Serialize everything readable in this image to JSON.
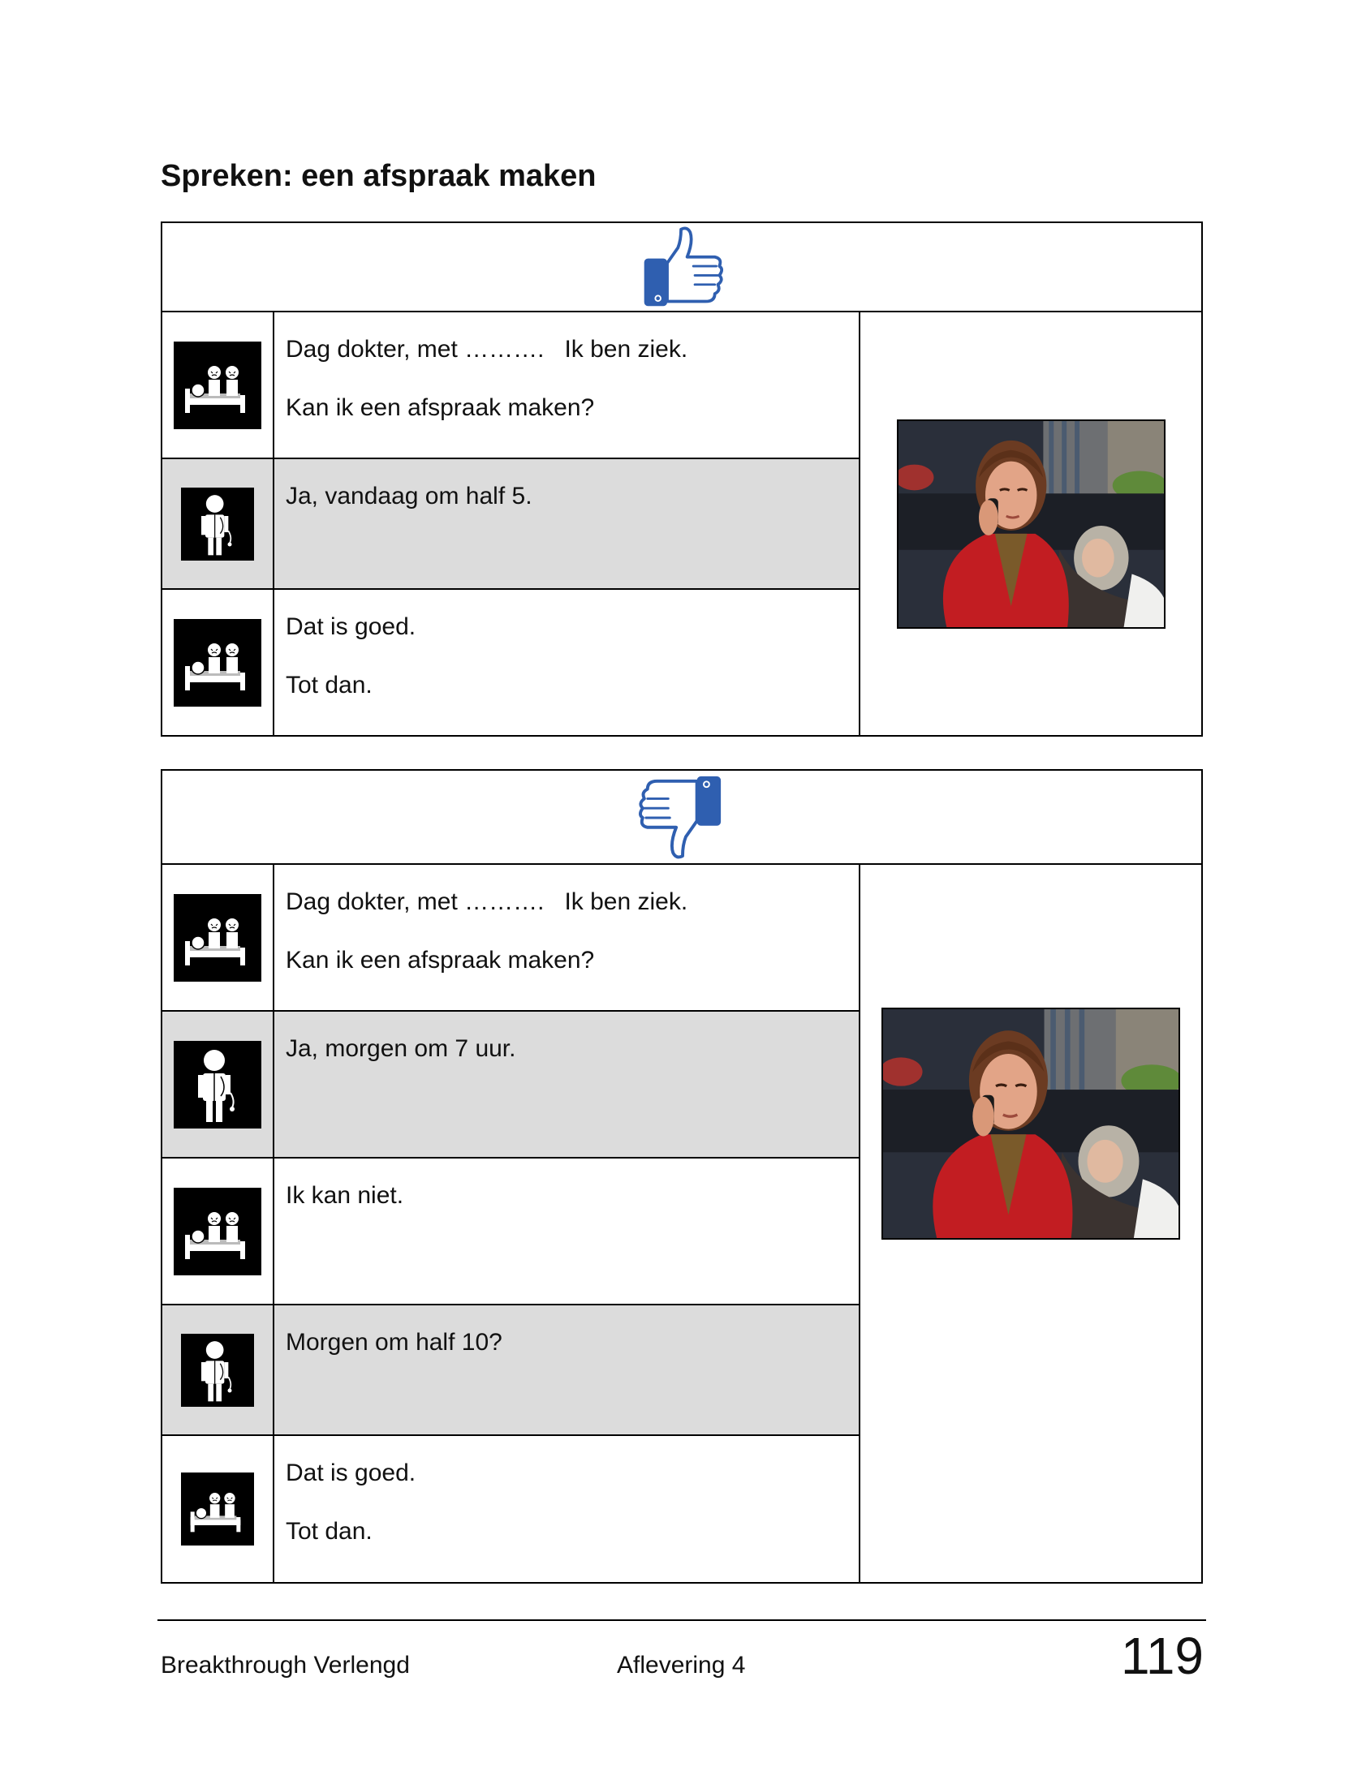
{
  "title": "Spreken: een afspraak maken",
  "colors": {
    "thumb": "#2f5fb0",
    "row_shade": "#dcdcdc"
  },
  "sections": [
    {
      "header_icon": "thumbs-up-icon",
      "rows": [
        {
          "speaker": "patient",
          "icon": "patient-with-visitors-icon",
          "lines": [
            "Dag dokter, met ……….   Ik ben ziek.",
            "Kan ik een afspraak maken?"
          ]
        },
        {
          "speaker": "doctor",
          "icon": "doctor-icon",
          "lines": [
            "Ja, vandaag om half 5."
          ]
        },
        {
          "speaker": "patient",
          "icon": "patient-with-visitors-icon",
          "lines": [
            "Dat is goed.",
            "Tot dan."
          ]
        }
      ]
    },
    {
      "header_icon": "thumbs-down-icon",
      "rows": [
        {
          "speaker": "patient",
          "icon": "patient-with-visitors-icon",
          "lines": [
            "Dag dokter, met ……….   Ik ben ziek.",
            "Kan ik een afspraak maken?"
          ]
        },
        {
          "speaker": "doctor",
          "icon": "doctor-icon",
          "lines": [
            "Ja, morgen om 7 uur."
          ]
        },
        {
          "speaker": "patient",
          "icon": "patient-with-visitors-icon",
          "lines": [
            "Ik kan niet."
          ]
        },
        {
          "speaker": "doctor",
          "icon": "doctor-icon",
          "lines": [
            "Morgen om half 10?"
          ]
        },
        {
          "speaker": "patient",
          "icon": "patient-with-visitors-icon",
          "lines": [
            "Dat is goed.",
            "Tot dan."
          ]
        }
      ]
    }
  ],
  "footer": {
    "left": "Breakthrough Verlengd",
    "center": "Aflevering 4",
    "page_number": "119"
  }
}
